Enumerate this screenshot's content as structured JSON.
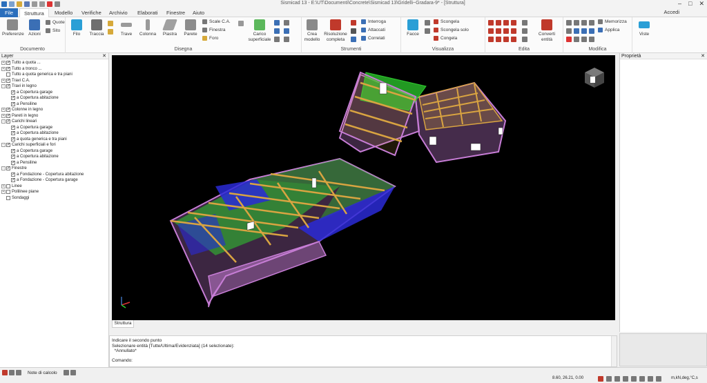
{
  "title": "Sismicad 13 - E:\\UT\\Documenti\\Concrete\\Sismicad 13\\Gridelli~Gradara-9* - [Struttura]",
  "tabs": [
    "File",
    "Struttura",
    "Modello",
    "Verifiche",
    "Archivio",
    "Elaborati",
    "Finestre",
    "Aiuto"
  ],
  "active_tab": "Struttura",
  "user": "Accedi",
  "ribbon": {
    "documento": {
      "label": "Documento",
      "preferenze": "Preferenze",
      "azioni": "Azioni",
      "quote": "Quote",
      "sito": "Sito"
    },
    "disegna": {
      "label": "Disegna",
      "filo": "Filo",
      "traccia": "Traccia",
      "trave": "Trave",
      "colonna": "Colonna",
      "piastra": "Piastra",
      "parete": "Parete",
      "scale": "Scale C.A.",
      "finestra": "Finestra",
      "foro": "Foro",
      "carico": "Carico superficiale"
    },
    "strumenti": {
      "label": "Strumenti",
      "crea": "Crea modello",
      "risoluzione": "Risoluzione completa",
      "interroga": "Interroga",
      "attaccati": "Attaccati",
      "correlati": "Correlati"
    },
    "visualizza": {
      "label": "Visualizza",
      "facce": "Facce",
      "scongela": "Scongela",
      "scongela_solo": "Scongela solo",
      "congela": "Congela"
    },
    "edita": {
      "label": "Edita",
      "converti": "Converti entità"
    },
    "modifica": {
      "label": "Modifica",
      "memorizza": "Memorizza",
      "applica": "Applica",
      "viste": "Viste"
    }
  },
  "layer_panel": {
    "title": "Layer",
    "items": [
      {
        "label": "Tutto a quota ...",
        "indent": 0,
        "exp": "+",
        "chk": true
      },
      {
        "label": "Tutto a tronco ...",
        "indent": 0,
        "exp": "+",
        "chk": true
      },
      {
        "label": "Tutto a quota generica e tra piani",
        "indent": 0,
        "exp": "",
        "chk": false
      },
      {
        "label": "Travi C.A.",
        "indent": 0,
        "exp": "+",
        "chk": true
      },
      {
        "label": "Travi in legno",
        "indent": 0,
        "exp": "-",
        "chk": true
      },
      {
        "label": "a Copertura garage",
        "indent": 1,
        "exp": "",
        "chk": true
      },
      {
        "label": "a Copertura abitazione",
        "indent": 1,
        "exp": "",
        "chk": true
      },
      {
        "label": "a Pensiline",
        "indent": 1,
        "exp": "",
        "chk": true
      },
      {
        "label": "Colonne in legno",
        "indent": 0,
        "exp": "+",
        "chk": true
      },
      {
        "label": "Pareti in legno",
        "indent": 0,
        "exp": "+",
        "chk": true
      },
      {
        "label": "Carichi lineari",
        "indent": 0,
        "exp": "-",
        "chk": true
      },
      {
        "label": "a Copertura garage",
        "indent": 1,
        "exp": "",
        "chk": true
      },
      {
        "label": "a Copertura abitazione",
        "indent": 1,
        "exp": "",
        "chk": true
      },
      {
        "label": "a quota generica e tra piani",
        "indent": 1,
        "exp": "",
        "chk": true
      },
      {
        "label": "Carichi superficiali e fori",
        "indent": 0,
        "exp": "-",
        "chk": true
      },
      {
        "label": "a Copertura garage",
        "indent": 1,
        "exp": "",
        "chk": true
      },
      {
        "label": "a Copertura abitazione",
        "indent": 1,
        "exp": "",
        "chk": true
      },
      {
        "label": "a Pensiline",
        "indent": 1,
        "exp": "",
        "chk": true
      },
      {
        "label": "Finestre",
        "indent": 0,
        "exp": "-",
        "chk": true
      },
      {
        "label": "a Fondazione - Copertura abitazione",
        "indent": 1,
        "exp": "",
        "chk": true
      },
      {
        "label": "a Fondazione - Copertura garage",
        "indent": 1,
        "exp": "",
        "chk": true
      },
      {
        "label": "Linee",
        "indent": 0,
        "exp": "+",
        "chk": false
      },
      {
        "label": "Polilinee piane",
        "indent": 0,
        "exp": "+",
        "chk": false
      },
      {
        "label": "Sondaggi",
        "indent": 0,
        "exp": "",
        "chk": false
      }
    ]
  },
  "viewport_tab": "Struttura",
  "properties_title": "Proprietà",
  "command": {
    "lines": [
      "Indicare il secondo punto",
      "Selezionare entità [Tutte/Ultima/Evidenziata] (14 selezionate):",
      "  *Annullato*"
    ],
    "prompt": "Comando:"
  },
  "status": {
    "notes": "Note di calcolo",
    "coords": "8.60, 26.21, 0.00",
    "units": "m,kN,deg,°C,s"
  },
  "colors": {
    "file_tab": "#2a6ebc",
    "viewport_bg": "#000000",
    "wall": "#c77dd6",
    "beam": "#d9a441",
    "green": "#2ecc2e",
    "blue": "#2a2ad6"
  }
}
